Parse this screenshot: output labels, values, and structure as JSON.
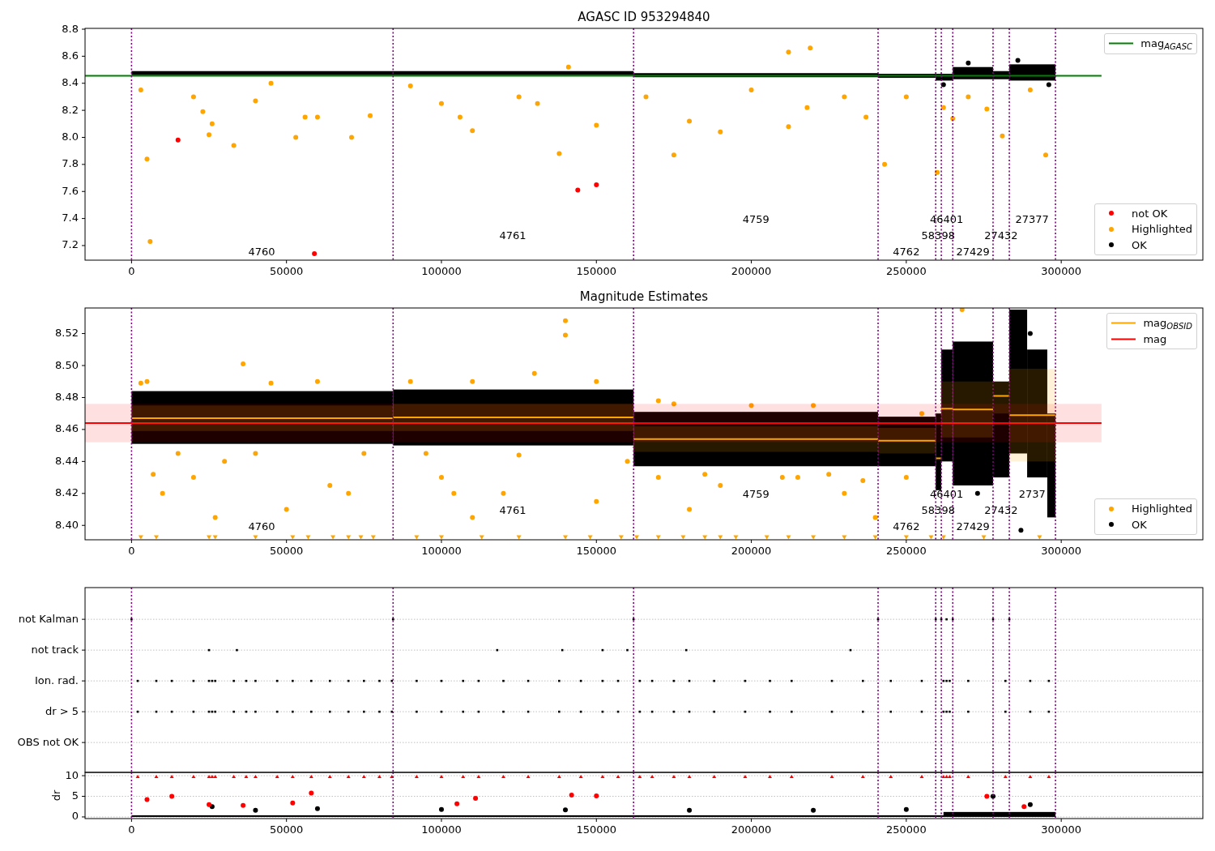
{
  "figure": {
    "panels": [
      {
        "chart_data": {
          "type": "scatter",
          "title": "AGASC ID 953294840",
          "xlim": [
            -15000,
            345700
          ],
          "ylim": [
            7.092,
            8.806
          ],
          "xticks": [
            0,
            50000,
            100000,
            150000,
            200000,
            250000,
            300000
          ],
          "yticks": [
            {
              "value": 7.2,
              "label": "7.2"
            },
            {
              "value": 7.4,
              "label": "7.4"
            },
            {
              "value": 7.6,
              "label": "7.6"
            },
            {
              "value": 7.8,
              "label": "7.8"
            },
            {
              "value": 8.0,
              "label": "8.0"
            },
            {
              "value": 8.2,
              "label": "8.2"
            },
            {
              "value": 8.4,
              "label": "8.4"
            },
            {
              "value": 8.6,
              "label": "8.6"
            },
            {
              "value": 8.8,
              "label": "8.8"
            }
          ],
          "series": [
            {
              "name": "mag$_{AGASC}$",
              "type": "line",
              "color": "#008000",
              "marker": "none",
              "x": [
                -15000,
                313000
              ],
              "values": [
                8.455,
                8.455
              ]
            },
            {
              "name": "not OK",
              "color": "#ff0000",
              "marker": "circle",
              "x": [
                15000,
                59000,
                144000,
                150000
              ],
              "values": [
                7.98,
                7.14,
                7.61,
                7.65
              ]
            },
            {
              "name": "Highlighted",
              "color": "#ffa500",
              "marker": "circle",
              "x": [
                5000,
                6000,
                25000,
                33000,
                53000,
                71000,
                20000,
                40000,
                110000,
                138000,
                150000,
                175000,
                190000,
                212000,
                219000,
                212000,
                243000,
                260000,
                265000,
                281000,
                295000,
                141000,
                60000,
                100000,
                125000,
                230000,
                3000,
                45000,
                90000,
                200000,
                250000,
                270000,
                23000,
                26000,
                56000,
                77000,
                106000,
                131000,
                166000,
                180000,
                218000,
                237000,
                262000,
                276000,
                290000
              ],
              "values": [
                7.84,
                7.23,
                8.02,
                7.94,
                8.0,
                8.0,
                8.3,
                8.27,
                8.05,
                7.88,
                8.09,
                7.87,
                8.04,
                8.63,
                8.66,
                8.08,
                7.8,
                7.74,
                8.14,
                8.01,
                7.87,
                8.52,
                8.15,
                8.25,
                8.3,
                8.3,
                8.35,
                8.4,
                8.38,
                8.35,
                8.3,
                8.3,
                8.19,
                8.1,
                8.15,
                8.16,
                8.15,
                8.25,
                8.3,
                8.12,
                8.22,
                8.15,
                8.22,
                8.21,
                8.35
              ]
            },
            {
              "name": "OK",
              "color": "#000000",
              "marker": "circle",
              "x": [
                262000,
                270000,
                286000,
                296000
              ],
              "values": [
                8.39,
                8.55,
                8.57,
                8.39
              ]
            }
          ],
          "legend": [
            "upper right",
            "lower right"
          ],
          "ref_lines": [
            {
              "axis": "x",
              "value": 0,
              "color": "#800080"
            },
            {
              "axis": "x",
              "value": 84400,
              "color": "#800080"
            },
            {
              "axis": "x",
              "value": 162000,
              "color": "#800080"
            },
            {
              "axis": "x",
              "value": 240900,
              "color": "#800080"
            },
            {
              "axis": "x",
              "value": 259500,
              "color": "#800080"
            },
            {
              "axis": "x",
              "value": 261300,
              "color": "#800080"
            },
            {
              "axis": "x",
              "value": 265000,
              "color": "#800080"
            },
            {
              "axis": "x",
              "value": 278000,
              "color": "#800080"
            },
            {
              "axis": "x",
              "value": 283250,
              "color": "#800080"
            },
            {
              "axis": "x",
              "value": 298150,
              "color": "#800080"
            }
          ],
          "annotations": [
            "4760",
            "4761",
            "4759",
            "4762",
            "58398",
            "46401",
            "27429",
            "27432",
            "27377"
          ]
        }
      },
      {
        "chart_data": {
          "type": "scatter",
          "title": "Magnitude Estimates",
          "xlim": [
            -15000,
            345700
          ],
          "ylim": [
            8.391,
            8.536
          ],
          "xticks": [
            0,
            50000,
            100000,
            150000,
            200000,
            250000,
            300000
          ],
          "yticks": [
            {
              "value": 8.4,
              "label": "8.40"
            },
            {
              "value": 8.42,
              "label": "8.42"
            },
            {
              "value": 8.44,
              "label": "8.44"
            },
            {
              "value": 8.46,
              "label": "8.46"
            },
            {
              "value": 8.48,
              "label": "8.48"
            },
            {
              "value": 8.5,
              "label": "8.50"
            },
            {
              "value": 8.52,
              "label": "8.52"
            }
          ],
          "series": [
            {
              "name": "mag$_{OBSID}$",
              "type": "line",
              "color": "#ffa500",
              "marker": "none",
              "x": [
                0,
                84400,
                84400,
                162000,
                162000,
                240900,
                240900,
                259500,
                259500,
                261300,
                261300,
                265000,
                265000,
                278000,
                278000,
                283250,
                283250,
                298150
              ],
              "values": [
                8.467,
                8.467,
                8.4675,
                8.4675,
                8.454,
                8.454,
                8.453,
                8.453,
                8.442,
                8.442,
                8.473,
                8.473,
                8.4725,
                8.4725,
                8.481,
                8.481,
                8.469,
                8.469
              ]
            },
            {
              "name": "mag",
              "type": "line",
              "color": "#ff0000",
              "marker": "none",
              "x": [
                -15000,
                313000
              ],
              "values": [
                8.464,
                8.464
              ]
            },
            {
              "name": "Highlighted",
              "color": "#ffa500",
              "marker": "circle",
              "x": [
                36000,
                140000,
                140000,
                5000,
                30000,
                10000,
                20000,
                50000,
                70000,
                100000,
                110000,
                120000,
                150000,
                170000,
                180000,
                190000,
                215000,
                230000,
                90000,
                130000,
                60000,
                170000,
                200000,
                255000,
                268000,
                27000,
                240000,
                15000,
                40000,
                75000,
                95000,
                125000,
                185000,
                225000,
                250000,
                3000,
                45000,
                110000,
                150000,
                175000,
                220000,
                7000,
                64000,
                104000,
                160000,
                210000,
                236000
              ],
              "values": [
                8.501,
                8.528,
                8.519,
                8.49,
                8.44,
                8.42,
                8.43,
                8.41,
                8.42,
                8.43,
                8.405,
                8.42,
                8.415,
                8.43,
                8.41,
                8.425,
                8.43,
                8.42,
                8.49,
                8.495,
                8.49,
                8.478,
                8.475,
                8.47,
                8.535,
                8.405,
                8.405,
                8.445,
                8.445,
                8.445,
                8.445,
                8.444,
                8.432,
                8.432,
                8.43,
                8.489,
                8.489,
                8.49,
                8.49,
                8.476,
                8.475,
                8.432,
                8.425,
                8.42,
                8.44,
                8.43,
                8.428
              ]
            },
            {
              "name": "OK",
              "color": "#000000",
              "marker": "circle",
              "x": [
                287000,
                273000,
                290000
              ],
              "values": [
                8.397,
                8.42,
                8.52
              ]
            },
            {
              "color": "#ffa500",
              "marker": "triangle",
              "x": [
                3000,
                8000,
                25000,
                27000,
                40000,
                52000,
                57000,
                65000,
                70000,
                74000,
                78000,
                92000,
                100000,
                113000,
                125000,
                140000,
                148000,
                158000,
                163000,
                170000,
                178000,
                185000,
                190000,
                195000,
                205000,
                212000,
                220000,
                230000,
                240000,
                250000,
                258000,
                262000,
                275000,
                293000
              ],
              "values": [
                8.3925,
                8.3925,
                8.3925,
                8.3925,
                8.3925,
                8.3925,
                8.3925,
                8.3925,
                8.3925,
                8.3925,
                8.3925,
                8.3925,
                8.3925,
                8.3925,
                8.3925,
                8.3925,
                8.3925,
                8.3925,
                8.3925,
                8.3925,
                8.3925,
                8.3925,
                8.3925,
                8.3925,
                8.3925,
                8.3925,
                8.3925,
                8.3925,
                8.3925,
                8.3925,
                8.3925,
                8.3925,
                8.3925,
                8.3925
              ]
            }
          ],
          "legend": [
            "upper right",
            "lower right"
          ],
          "bands": [
            {
              "axis": "y",
              "from": 8.452,
              "to": 8.476,
              "color": "#ff0000"
            }
          ],
          "ref_lines": [
            {
              "axis": "x",
              "value": 0,
              "color": "#800080"
            },
            {
              "axis": "x",
              "value": 84400,
              "color": "#800080"
            },
            {
              "axis": "x",
              "value": 162000,
              "color": "#800080"
            },
            {
              "axis": "x",
              "value": 240900,
              "color": "#800080"
            },
            {
              "axis": "x",
              "value": 259500,
              "color": "#800080"
            },
            {
              "axis": "x",
              "value": 261300,
              "color": "#800080"
            },
            {
              "axis": "x",
              "value": 265000,
              "color": "#800080"
            },
            {
              "axis": "x",
              "value": 278000,
              "color": "#800080"
            },
            {
              "axis": "x",
              "value": 283250,
              "color": "#800080"
            },
            {
              "axis": "x",
              "value": 298150,
              "color": "#800080"
            }
          ],
          "annotations": [
            "4760",
            "4761",
            "4759",
            "4762",
            "58398",
            "46401",
            "27429",
            "27432",
            "2737"
          ]
        }
      },
      {
        "chart_data": {
          "type": "scatter",
          "orientation": "horizontal",
          "xlim": [
            -15000,
            345700
          ],
          "categories": [
            "not Kalman",
            "not track",
            "Ion. rad.",
            "dr > 5",
            "OBS not OK"
          ],
          "series": [
            {
              "color": "#000000",
              "marker": "square",
              "values": [
                0,
                25000,
                2000,
                2000,
                null
              ]
            },
            {
              "color": "#000000",
              "marker": "square",
              "values": [
                84400,
                34000,
                8000,
                8000,
                null
              ]
            },
            {
              "color": "#000000",
              "marker": "square",
              "values": [
                162000,
                118000,
                13000,
                13000,
                null
              ]
            },
            {
              "color": "#000000",
              "marker": "square",
              "values": [
                240900,
                139000,
                20000,
                20000,
                null
              ]
            },
            {
              "color": "#000000",
              "marker": "square",
              "values": [
                259500,
                152000,
                25000,
                25000,
                null
              ]
            },
            {
              "color": "#000000",
              "marker": "square",
              "values": [
                261300,
                160000,
                26000,
                26000,
                null
              ]
            },
            {
              "color": "#000000",
              "marker": "square",
              "values": [
                263000,
                179000,
                27000,
                27000,
                null
              ]
            },
            {
              "color": "#000000",
              "marker": "square",
              "values": [
                265000,
                232000,
                33000,
                33000,
                null
              ]
            },
            {
              "color": "#000000",
              "marker": "square",
              "values": [
                278000,
                null,
                37000,
                37000,
                null
              ]
            },
            {
              "color": "#000000",
              "marker": "square",
              "values": [
                283250,
                null,
                40000,
                40000,
                null
              ]
            },
            {
              "color": "#000000",
              "marker": "square",
              "values": [
                null,
                null,
                47000,
                47000,
                null
              ]
            },
            {
              "color": "#000000",
              "marker": "square",
              "values": [
                null,
                null,
                52000,
                52000,
                null
              ]
            },
            {
              "color": "#000000",
              "marker": "square",
              "values": [
                null,
                null,
                58000,
                58000,
                null
              ]
            },
            {
              "color": "#000000",
              "marker": "square",
              "values": [
                null,
                null,
                64000,
                64000,
                null
              ]
            },
            {
              "color": "#000000",
              "marker": "square",
              "values": [
                null,
                null,
                70000,
                70000,
                null
              ]
            },
            {
              "color": "#000000",
              "marker": "square",
              "values": [
                null,
                null,
                75000,
                75000,
                null
              ]
            },
            {
              "color": "#000000",
              "marker": "square",
              "values": [
                null,
                null,
                80000,
                80000,
                null
              ]
            },
            {
              "color": "#000000",
              "marker": "square",
              "values": [
                null,
                null,
                84000,
                84000,
                null
              ]
            },
            {
              "color": "#000000",
              "marker": "square",
              "values": [
                null,
                null,
                92000,
                92000,
                null
              ]
            },
            {
              "color": "#000000",
              "marker": "square",
              "values": [
                null,
                null,
                100000,
                100000,
                null
              ]
            },
            {
              "color": "#000000",
              "marker": "square",
              "values": [
                null,
                null,
                107000,
                107000,
                null
              ]
            },
            {
              "color": "#000000",
              "marker": "square",
              "values": [
                null,
                null,
                112000,
                112000,
                null
              ]
            },
            {
              "color": "#000000",
              "marker": "square",
              "values": [
                null,
                null,
                120000,
                120000,
                null
              ]
            },
            {
              "color": "#000000",
              "marker": "square",
              "values": [
                null,
                null,
                128000,
                128000,
                null
              ]
            },
            {
              "color": "#000000",
              "marker": "square",
              "values": [
                null,
                null,
                138000,
                138000,
                null
              ]
            },
            {
              "color": "#000000",
              "marker": "square",
              "values": [
                null,
                null,
                145000,
                145000,
                null
              ]
            },
            {
              "color": "#000000",
              "marker": "square",
              "values": [
                null,
                null,
                152000,
                152000,
                null
              ]
            },
            {
              "color": "#000000",
              "marker": "square",
              "values": [
                null,
                null,
                157000,
                157000,
                null
              ]
            },
            {
              "color": "#000000",
              "marker": "square",
              "values": [
                null,
                null,
                164000,
                164000,
                null
              ]
            },
            {
              "color": "#000000",
              "marker": "square",
              "values": [
                null,
                null,
                168000,
                168000,
                null
              ]
            },
            {
              "color": "#000000",
              "marker": "square",
              "values": [
                null,
                null,
                175000,
                175000,
                null
              ]
            },
            {
              "color": "#000000",
              "marker": "square",
              "values": [
                null,
                null,
                180000,
                180000,
                null
              ]
            },
            {
              "color": "#000000",
              "marker": "square",
              "values": [
                null,
                null,
                188000,
                188000,
                null
              ]
            },
            {
              "color": "#000000",
              "marker": "square",
              "values": [
                null,
                null,
                198000,
                198000,
                null
              ]
            },
            {
              "color": "#000000",
              "marker": "square",
              "values": [
                null,
                null,
                206000,
                206000,
                null
              ]
            },
            {
              "color": "#000000",
              "marker": "square",
              "values": [
                null,
                null,
                213000,
                213000,
                null
              ]
            },
            {
              "color": "#000000",
              "marker": "square",
              "values": [
                null,
                null,
                226000,
                226000,
                null
              ]
            },
            {
              "color": "#000000",
              "marker": "square",
              "values": [
                null,
                null,
                236000,
                236000,
                null
              ]
            },
            {
              "color": "#000000",
              "marker": "square",
              "values": [
                null,
                null,
                245000,
                245000,
                null
              ]
            },
            {
              "color": "#000000",
              "marker": "square",
              "values": [
                null,
                null,
                255000,
                255000,
                null
              ]
            },
            {
              "color": "#000000",
              "marker": "square",
              "values": [
                null,
                null,
                262000,
                262000,
                null
              ]
            },
            {
              "color": "#000000",
              "marker": "square",
              "values": [
                null,
                null,
                263000,
                263000,
                null
              ]
            },
            {
              "color": "#000000",
              "marker": "square",
              "values": [
                null,
                null,
                264000,
                264000,
                null
              ]
            },
            {
              "color": "#000000",
              "marker": "square",
              "values": [
                null,
                null,
                270000,
                270000,
                null
              ]
            },
            {
              "color": "#000000",
              "marker": "square",
              "values": [
                null,
                null,
                282000,
                282000,
                null
              ]
            },
            {
              "color": "#000000",
              "marker": "square",
              "values": [
                null,
                null,
                290000,
                290000,
                null
              ]
            },
            {
              "color": "#000000",
              "marker": "square",
              "values": [
                null,
                null,
                296000,
                296000,
                null
              ]
            }
          ],
          "ref_lines": [
            {
              "axis": "x",
              "value": 0,
              "color": "#800080"
            },
            {
              "axis": "x",
              "value": 84400,
              "color": "#800080"
            },
            {
              "axis": "x",
              "value": 162000,
              "color": "#800080"
            },
            {
              "axis": "x",
              "value": 240900,
              "color": "#800080"
            },
            {
              "axis": "x",
              "value": 259500,
              "color": "#800080"
            },
            {
              "axis": "x",
              "value": 261300,
              "color": "#800080"
            },
            {
              "axis": "x",
              "value": 265000,
              "color": "#800080"
            },
            {
              "axis": "x",
              "value": 278000,
              "color": "#800080"
            },
            {
              "axis": "x",
              "value": 283250,
              "color": "#800080"
            },
            {
              "axis": "x",
              "value": 298150,
              "color": "#800080"
            }
          ]
        }
      },
      {
        "chart_data": {
          "type": "scatter",
          "ylabel": "dr",
          "xlim": [
            -15000,
            345700
          ],
          "ylim": [
            -0.4,
            10.8
          ],
          "xticks": [
            0,
            50000,
            100000,
            150000,
            200000,
            250000,
            300000
          ],
          "yticks": [
            {
              "value": 0,
              "label": "0"
            },
            {
              "value": 5,
              "label": "5"
            },
            {
              "value": 10,
              "label": "10"
            }
          ],
          "series": [
            {
              "color": "#000000",
              "marker": "circle",
              "x": [
                26000,
                60000,
                100000,
                180000,
                278000,
                290000,
                40000,
                140000,
                220000,
                250000
              ],
              "values": [
                2.5,
                2,
                1.8,
                1.6,
                5,
                3,
                1.6,
                1.7,
                1.6,
                1.8
              ]
            },
            {
              "color": "#ff0000",
              "marker": "triangle",
              "x": [
                2000,
                8000,
                13000,
                20000,
                25000,
                26000,
                27000,
                33000,
                37000,
                40000,
                47000,
                52000,
                58000,
                64000,
                70000,
                75000,
                80000,
                84000,
                92000,
                100000,
                107000,
                112000,
                120000,
                128000,
                138000,
                145000,
                152000,
                157000,
                164000,
                168000,
                175000,
                180000,
                188000,
                198000,
                206000,
                213000,
                226000,
                236000,
                245000,
                255000,
                262000,
                263000,
                264000,
                270000,
                282000,
                290000,
                296000
              ],
              "values": [
                9.8,
                9.8,
                9.8,
                9.8,
                9.8,
                9.8,
                9.8,
                9.8,
                9.8,
                9.8,
                9.8,
                9.8,
                9.8,
                9.8,
                9.8,
                9.8,
                9.8,
                9.8,
                9.8,
                9.8,
                9.8,
                9.8,
                9.8,
                9.8,
                9.8,
                9.8,
                9.8,
                9.8,
                9.8,
                9.8,
                9.8,
                9.8,
                9.8,
                9.8,
                9.8,
                9.8,
                9.8,
                9.8,
                9.8,
                9.8,
                9.8,
                9.8,
                9.8,
                9.8,
                9.8,
                9.8,
                9.8
              ]
            },
            {
              "color": "#ff0000",
              "marker": "circle",
              "x": [
                5000,
                13000,
                25000,
                58000,
                52000,
                105000,
                111000,
                142000,
                150000,
                36000,
                276000,
                288000
              ],
              "values": [
                4.2,
                5,
                3,
                5.8,
                3.4,
                3.2,
                4.5,
                5.3,
                5.1,
                2.8,
                5,
                2.5
              ]
            }
          ],
          "ref_lines": [
            {
              "axis": "x",
              "value": 0,
              "color": "#800080"
            },
            {
              "axis": "x",
              "value": 84400,
              "color": "#800080"
            },
            {
              "axis": "x",
              "value": 162000,
              "color": "#800080"
            },
            {
              "axis": "x",
              "value": 240900,
              "color": "#800080"
            },
            {
              "axis": "x",
              "value": 259500,
              "color": "#800080"
            },
            {
              "axis": "x",
              "value": 261300,
              "color": "#800080"
            },
            {
              "axis": "x",
              "value": 265000,
              "color": "#800080"
            },
            {
              "axis": "x",
              "value": 278000,
              "color": "#800080"
            },
            {
              "axis": "x",
              "value": 283250,
              "color": "#800080"
            },
            {
              "axis": "x",
              "value": 298150,
              "color": "#800080"
            }
          ]
        }
      }
    ]
  }
}
